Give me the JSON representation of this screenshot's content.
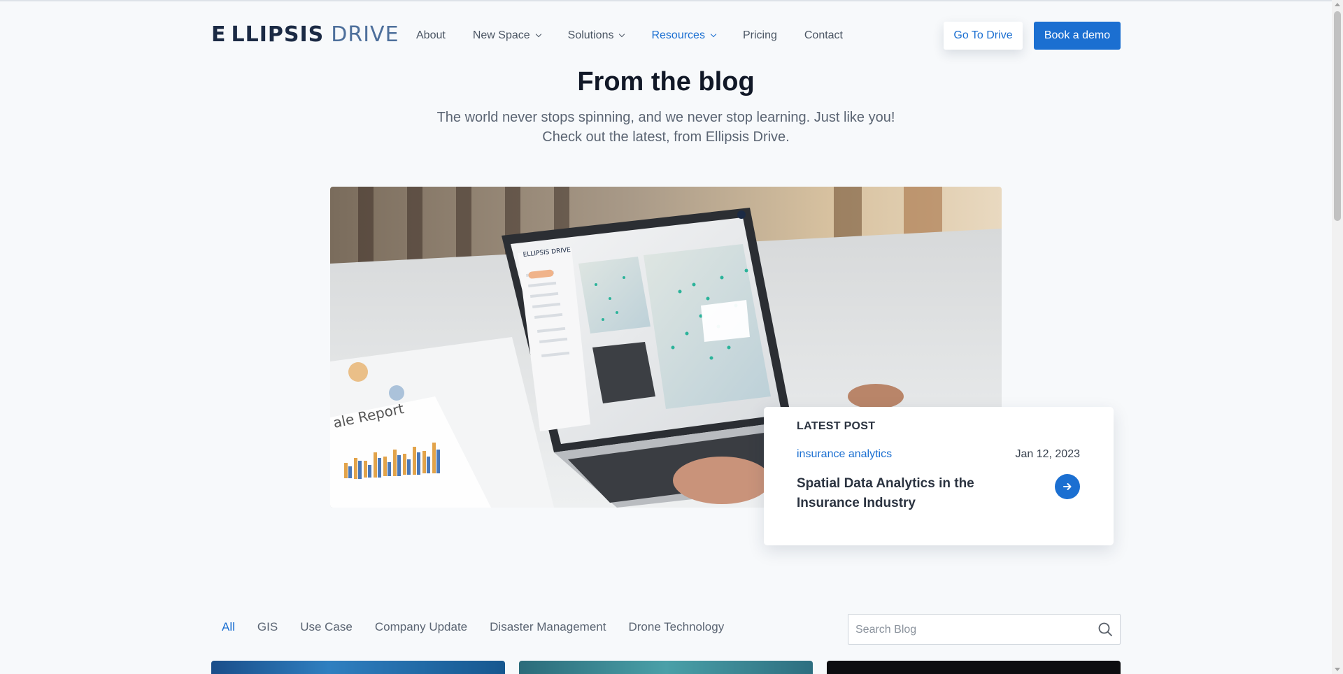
{
  "brand": {
    "name_a": "E LLIPSIS",
    "name_b": "DRIVE",
    "accent": "#1b6fd1"
  },
  "nav": {
    "items": [
      {
        "label": "About",
        "dropdown": false,
        "active": false
      },
      {
        "label": "New Space",
        "dropdown": true,
        "active": false
      },
      {
        "label": "Solutions",
        "dropdown": true,
        "active": false
      },
      {
        "label": "Resources",
        "dropdown": true,
        "active": true
      },
      {
        "label": "Pricing",
        "dropdown": false,
        "active": false
      },
      {
        "label": "Contact",
        "dropdown": false,
        "active": false
      }
    ],
    "go_to_drive": "Go To Drive",
    "book_demo": "Book a demo"
  },
  "hero": {
    "title": "From the blog",
    "subtitle": "The world never stops spinning, and we never stop learning. Just like you! Check out the latest, from Ellipsis Drive."
  },
  "latest_post": {
    "kicker": "LATEST POST",
    "category": "insurance analytics",
    "date": "Jan 12, 2023",
    "title": "Spatial Data Analytics in the Insurance Industry",
    "arrow_icon": "arrow-right-icon"
  },
  "filters": {
    "items": [
      "All",
      "GIS",
      "Use Case",
      "Company Update",
      "Disaster Management",
      "Drone Technology"
    ],
    "active": "All"
  },
  "search": {
    "placeholder": "Search Blog",
    "value": ""
  }
}
